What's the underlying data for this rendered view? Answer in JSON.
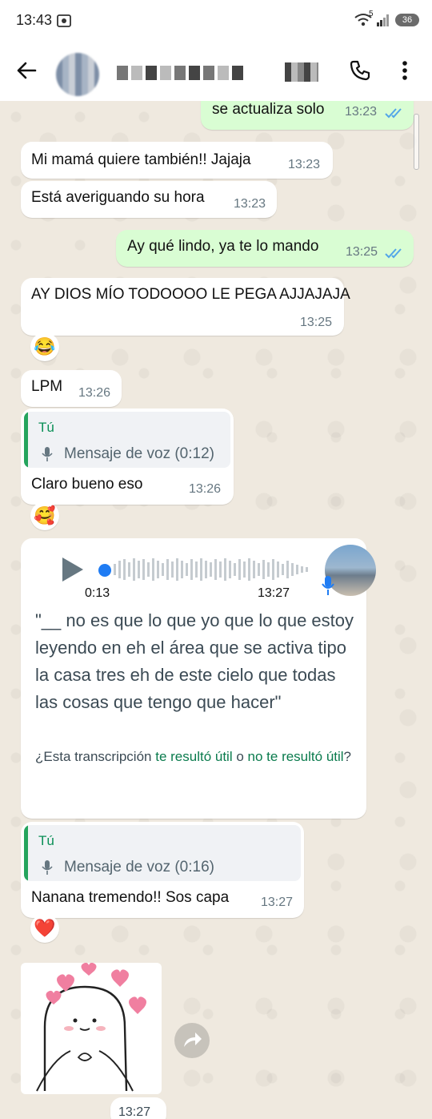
{
  "status_bar": {
    "time": "13:43",
    "network_gen": "5",
    "battery": "36"
  },
  "header": {
    "contact_name": "",
    "icons": [
      "back-arrow-icon",
      "video-call-icon",
      "phone-icon",
      "more-vert-icon"
    ]
  },
  "messages": {
    "m1": {
      "text": "se actualiza solo",
      "time": "13:23"
    },
    "m2": {
      "text": "Mi mamá quiere también!! Jajaja",
      "time": "13:23"
    },
    "m3": {
      "text": "Está averiguando su hora",
      "time": "13:23"
    },
    "m4": {
      "text": "Ay qué lindo, ya te lo mando",
      "time": "13:25"
    },
    "m5": {
      "text": "AY DIOS MÍO TODOOOO LE PEGA AJJAJAJA",
      "time": "13:25",
      "reaction": "😂"
    },
    "m6": {
      "text": "LPM",
      "time": "13:26"
    },
    "m7": {
      "quote_author": "Tú",
      "quote_text": "Mensaje de voz (0:12)",
      "text": "Claro bueno eso",
      "time": "13:26",
      "reaction": "🥰"
    },
    "m8": {
      "elapsed": "0:13",
      "time": "13:27",
      "transcript": "\"__ no es que lo que yo que lo que estoy leyendo en eh el área que se activa tipo la casa tres eh de este cielo que todas las cosas que tengo que hacer\"",
      "question_prefix": "¿Esta transcripción ",
      "useful": "te resultó útil",
      "or": " o ",
      "not_useful": "no te resultó útil",
      "question_suffix": "?"
    },
    "m9": {
      "quote_author": "Tú",
      "quote_text": "Mensaje de voz (0:16)",
      "text": "Nanana tremendo!! Sos capa",
      "time": "13:27",
      "reaction": "❤️"
    },
    "m10": {
      "type": "sticker",
      "time": "13:27"
    }
  },
  "colors": {
    "incoming": "#ffffff",
    "outgoing": "#d9fdd3",
    "wallpaper": "#efe9df",
    "read_ticks": "#53a6e8",
    "link_green": "#0a7b4d"
  }
}
